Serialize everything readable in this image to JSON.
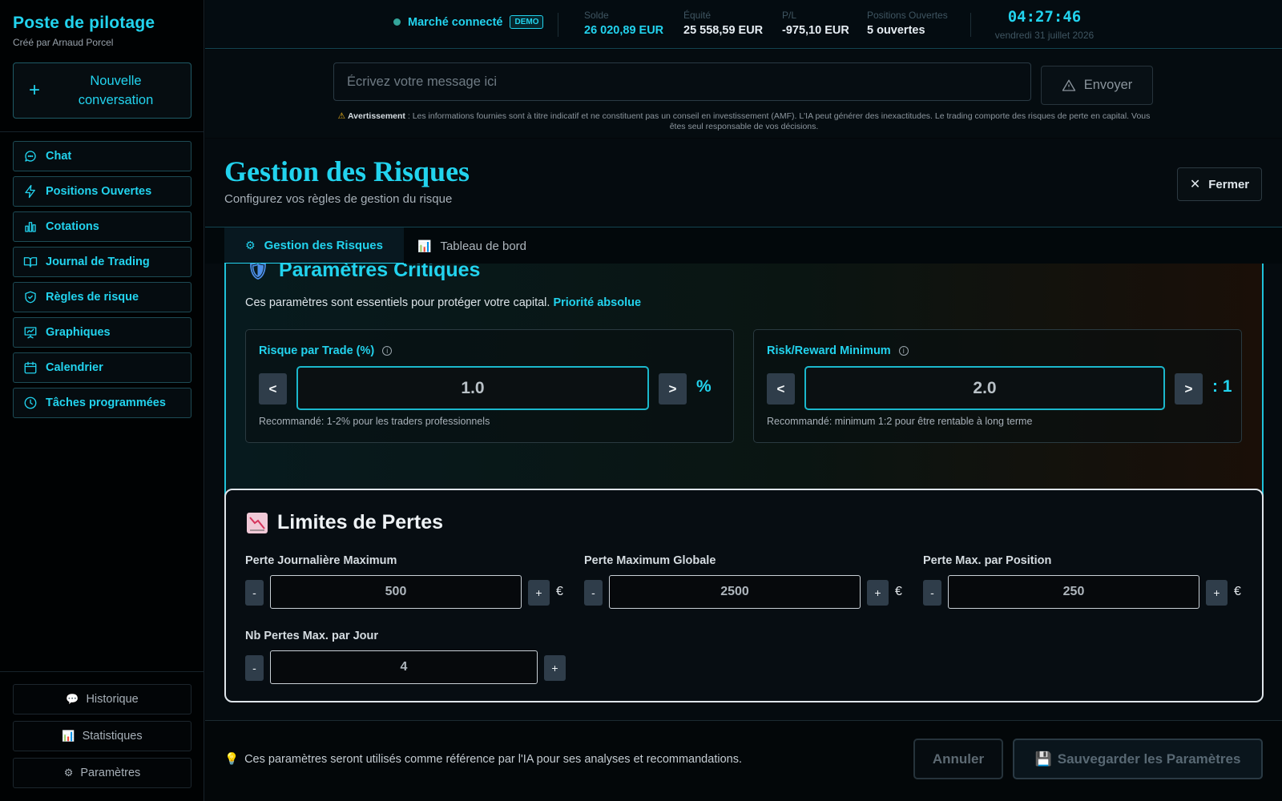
{
  "sidebar": {
    "title": "Poste de pilotage",
    "subtitle": "Créé par Arnaud Porcel",
    "new_conversation": "Nouvelle conversation",
    "nav": [
      {
        "label": "Chat",
        "icon": "chat-icon"
      },
      {
        "label": "Positions Ouvertes",
        "icon": "bolt-icon"
      },
      {
        "label": "Cotations",
        "icon": "bar-chart-icon"
      },
      {
        "label": "Journal de Trading",
        "icon": "book-icon"
      },
      {
        "label": "Règles de risque",
        "icon": "shield-icon"
      },
      {
        "label": "Graphiques",
        "icon": "presentation-chart-icon"
      },
      {
        "label": "Calendrier",
        "icon": "calendar-icon"
      },
      {
        "label": "Tâches programmées",
        "icon": "clock-icon"
      }
    ],
    "bottom": [
      {
        "label": "Historique",
        "icon": "speech-bubble-icon"
      },
      {
        "label": "Statistiques",
        "icon": "chart-icon"
      },
      {
        "label": "Paramètres",
        "icon": "gear-icon"
      }
    ]
  },
  "topbar": {
    "status": "Marché connecté",
    "badge": "DEMO",
    "stats": [
      {
        "label": "Solde",
        "value": "26 020,89 EUR",
        "color": "#22d3ee"
      },
      {
        "label": "Équité",
        "value": "25 558,59 EUR",
        "color": "#e6edf3"
      },
      {
        "label": "P/L",
        "value": "-975,10 EUR",
        "color": "#e6edf3"
      },
      {
        "label": "Positions Ouvertes",
        "value": "5 ouvertes",
        "color": "#e6edf3"
      }
    ],
    "time": "04:27:46",
    "date": "vendredi 31 juillet 2026"
  },
  "message": {
    "placeholder": "Écrivez votre message ici",
    "send": "Envoyer",
    "warning_label": "Avertissement",
    "warning_text": " : Les informations fournies sont à titre indicatif et ne constituent pas un conseil en investissement (AMF). L'IA peut générer des inexactitudes. Le trading comporte des risques de perte en capital. Vous êtes seul responsable de vos décisions."
  },
  "modal": {
    "title": "Gestion des Risques",
    "subtitle": "Configurez vos règles de gestion du risque",
    "close": "Fermer",
    "tabs": [
      {
        "label": "Gestion des Risques",
        "icon": "gear-icon"
      },
      {
        "label": "Tableau de bord",
        "icon": "chart-icon"
      }
    ],
    "critical": {
      "title": "Paramètres Critiques",
      "desc": "Ces paramètres sont essentiels pour protéger votre capital.",
      "priority": "Priorité absolue",
      "risk": {
        "label": "Risque par Trade (%)",
        "value": "1.0",
        "unit": "%",
        "dec": "<",
        "inc": ">",
        "hint": "Recommandé: 1-2% pour les traders professionnels"
      },
      "rr": {
        "label": "Risk/Reward Minimum",
        "value": "2.0",
        "unit": ": 1",
        "dec": "<",
        "inc": ">",
        "hint": "Recommandé: minimum 1:2 pour être rentable à long terme"
      }
    },
    "limits": {
      "title": "Limites de Pertes",
      "fields": [
        {
          "label": "Perte Journalière Maximum",
          "value": "500",
          "unit": "€"
        },
        {
          "label": "Perte Maximum Globale",
          "value": "2500",
          "unit": "€"
        },
        {
          "label": "Perte Max. par Position",
          "value": "250",
          "unit": "€"
        },
        {
          "label": "Nb Pertes Max. par Jour",
          "value": "4",
          "unit": ""
        }
      ],
      "dec": "-",
      "inc": "+"
    },
    "footer": {
      "note": "Ces paramètres seront utilisés comme référence par l'IA pour ses analyses et recommandations.",
      "cancel": "Annuler",
      "save": "Sauvegarder les Paramètres"
    }
  },
  "colors": {
    "accent": "#22d3ee",
    "status_dot": "#34a59a",
    "warning": "#f2b61c"
  }
}
